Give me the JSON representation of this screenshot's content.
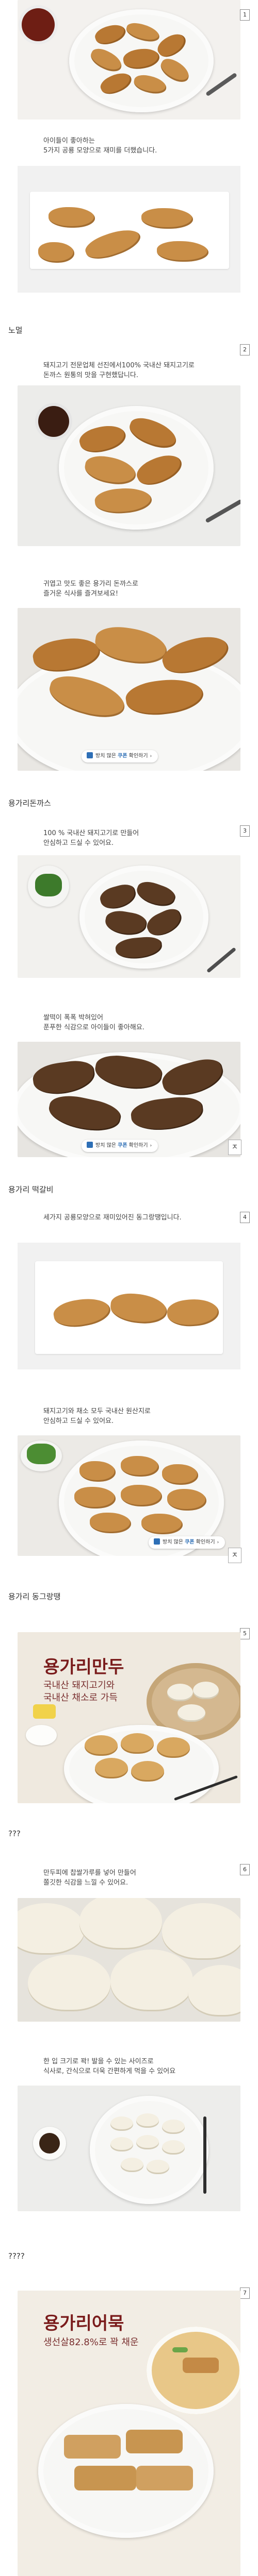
{
  "colors": {
    "accent": "#2e6fb6",
    "title_red": "#7a1c1c",
    "panel_grey": "#f1f1f1"
  },
  "sections": {
    "s1": {
      "badge": "1",
      "copy": [
        "아이들이 좋아하는",
        "5가지 공룡 모양으로 재미를 더했습니다."
      ]
    },
    "s2": {
      "heading": "노멀",
      "badge": "2",
      "copy_top": [
        "돼지고기 전문업체 선진에서100% 국내산 돼지고기로",
        "돈까스 원통의 맛을 구현했답니다."
      ],
      "copy_mid": [
        "귀엽고 맛도 좋은 용가리 돈까스로",
        "즐거운 식사를 즐겨보세요!"
      ],
      "pill": {
        "prefix": "방치 많은",
        "highlight": "쿠폰",
        "suffix": "확인하기",
        "chev": "›"
      },
      "scroll_top": "ㅈ"
    },
    "s3": {
      "heading": "용가리돈까스",
      "badge": "3",
      "copy_top": [
        "100 % 국내산 돼지고기로 만들어",
        "안심하고 드실 수 있어요."
      ],
      "copy_mid": [
        "쌀떡이 폭폭 박혀있어",
        "푼푸한 식감으로 아이들이 좋아해요."
      ],
      "pill": {
        "prefix": "방치 많은",
        "highlight": "쿠폰",
        "suffix": "확인하기",
        "chev": "›"
      },
      "scroll_top": "ㅈ"
    },
    "s4": {
      "heading": "용가리 떡갈비",
      "badge": "4",
      "copy_top": [
        "세가지 공룡모양으로 재미있어진 동그랑땡입니다."
      ],
      "copy_mid": [
        "돼지고기와 채소 모두 국내산 원산지로",
        "안심하고 드실 수 있어요."
      ],
      "pill": {
        "prefix": "방치 많은",
        "highlight": "쿠폰",
        "suffix": "확인하기",
        "chev": "›"
      },
      "scroll_top": "ㅈ"
    },
    "s5": {
      "heading": "용가리 동그랑땡",
      "badge": "5",
      "title": "용가리만두",
      "subtitle": [
        "국내산 돼지고기와",
        "국내산 채소로 가득"
      ]
    },
    "s6": {
      "heading": "???",
      "badge": "6",
      "copy_top": [
        "만두피에 찹쌀가루를 넣어 만들어",
        "쫄깃한 식감을 느낄 수 있어요."
      ],
      "copy_mid": [
        "한 입 크기로 꽉! 발을 수 있는 사이즈로",
        "식사로, 간식으로 더욱 간편하게 먹을 수 있어요"
      ]
    },
    "s7": {
      "heading": "????",
      "badge": "7",
      "title": "용가리어묵",
      "subtitle": "생선살82.8%로 꽉 채운"
    }
  }
}
